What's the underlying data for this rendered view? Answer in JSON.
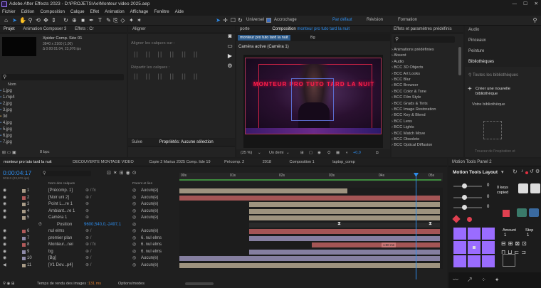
{
  "app": {
    "title": "Adobe After Effects 2023 - D:\\PROJETS\\Ae\\Monteur video 2025.aep"
  },
  "menu": [
    "Fichier",
    "Edition",
    "Composition",
    "Calque",
    "Effet",
    "Animation",
    "Affichage",
    "Fenêtre",
    "Aide"
  ],
  "toolbar": {
    "universal": "Universel",
    "snapping": "Accrochage",
    "workspace_default": "Par défaut",
    "workspace_revision": "Révision",
    "workspace_formation": "Formation"
  },
  "project": {
    "tab_project": "Projet",
    "tab_anim": "Animation Composer 3",
    "tab_effects": "Effets : Cr",
    "comp_name": "Xpider Comp. Sée 01",
    "comp_res": "3840 x 2160 (1,00)",
    "comp_dur": "Δ 0:00:01:04, 23,976 ips",
    "search_placeholder": "",
    "col_name": "Nom",
    "files": [
      "1.jpg",
      "1.mp4",
      "2.jpg",
      "3.jpg",
      "3d",
      "4.jpg",
      "5.jpg",
      "6.jpg",
      "7.jpg"
    ],
    "bpc": "8 bpc"
  },
  "align": {
    "title": "Aligner",
    "align_to": "Aligner les calques sur :",
    "distribute": "Répartir les calques :"
  },
  "smoother": {
    "title": "Suive",
    "props": "Propriétés: Aucune sélection"
  },
  "comp_panel": {
    "tab_source": "porte",
    "tab_comp_prefix": "Composition",
    "tab_comp_name": "monteur pro tuto tard la nuit",
    "sub_tab": "monteur pro tuto tard la nuit",
    "sub_tab2": "Bg",
    "camera": "Caméra active (Caméra 1)",
    "overlay_text": "MONTEUR PRO TUTO TARD LA NUIT",
    "zoom": "(25 %)",
    "quality": "Un demi",
    "exposure": "+0,0"
  },
  "effects_panel": {
    "title": "Effets et paramètres prédéfinis",
    "search_placeholder": "",
    "items": [
      "Animations prédéfinies",
      "Absent",
      "Audio",
      "BCC 3D Objects",
      "BCC Art Looks",
      "BCC Blur",
      "BCC Browser",
      "BCC Color & Tone",
      "BCC Film Style",
      "BCC Grads & Tints",
      "BCC Image Restoration",
      "BCC Key & Blend",
      "BCC Lens",
      "BCC Lights",
      "BCC Match Move",
      "BCC Obsolete",
      "BCC Optical Diffusion"
    ]
  },
  "libraries": {
    "tabs": [
      "Audio",
      "Pinceaux",
      "Peinture",
      "Bibliothèques"
    ],
    "search_placeholder": "Toutes les bibliothèques",
    "create": "Créer une nouvelle bibliothèque",
    "yours": "Votre bibliothèque",
    "import": "Trouvez de l'inspiration et"
  },
  "timeline": {
    "tabs": [
      "monteur pro tuto tard la nuit",
      "DECOUVERTE MONTAGE VIDEO",
      "Copie 2 Marius 2025 Comp. lide 19",
      "Précomp. 2",
      "2018",
      "Composition 1",
      "laptop_comp"
    ],
    "timecode": "0:00:04:17",
    "frame_info": "00113 (23,976 ips)",
    "col_layer_name": "Nom des calques",
    "col_parent": "Parent et lien",
    "ruler": [
      "00s",
      "01s",
      "02s",
      "03s",
      "04s",
      "05s"
    ],
    "layers": [
      {
        "num": "1",
        "name": "[Précomp. 1]",
        "parent": "Aucun(e)",
        "color": "#a89b87"
      },
      {
        "num": "2",
        "name": "[Noir uni 2]",
        "parent": "Aucun(e)",
        "color": "#b15a5a"
      },
      {
        "num": "3",
        "name": "Point L...re 1",
        "parent": "Aucun(e)",
        "color": "#a89b87"
      },
      {
        "num": "4",
        "name": "Ambiant...re 1",
        "parent": "Aucun(e)",
        "color": "#a89b87"
      },
      {
        "num": "5",
        "name": "Caméra 1",
        "parent": "Aucun(e)",
        "color": "#a89b87"
      },
      {
        "num": "",
        "name": "Position",
        "parent": "",
        "value": "9600,540,0,-2497,1",
        "color": ""
      },
      {
        "num": "6",
        "name": "nul elms",
        "parent": "Aucun(e)",
        "color": "#b15a5a"
      },
      {
        "num": "7",
        "name": "premier plan",
        "parent": "6. nul elms",
        "color": "#8e8aa8"
      },
      {
        "num": "8",
        "name": "Monteur...nei",
        "parent": "6. nul elms",
        "color": "#b15a5a"
      },
      {
        "num": "9",
        "name": "bg",
        "parent": "6. nul elms",
        "color": "#8e8aa8"
      },
      {
        "num": "10",
        "name": "[Bg]",
        "parent": "Aucun(e)",
        "color": "#8e8aa8"
      },
      {
        "num": "11",
        "name": "[V1 Dev...p4]",
        "parent": "Aucun(e)",
        "color": "#a89b87"
      }
    ],
    "bar_label": "1:00 mn",
    "footer_render": "Temps de rendu des images :",
    "footer_render_val": "131 ms",
    "footer_modes": "Options/modes"
  },
  "motion_tools": {
    "title": "Motion Tools Panel 2",
    "header": "Motion Tools Layout",
    "keys_copied": "0 keys copied",
    "slider1": "0",
    "slider2": "0",
    "slider3": "0",
    "amount_label": "Amount",
    "step_label": "Step",
    "amount": "1",
    "step": "1"
  }
}
